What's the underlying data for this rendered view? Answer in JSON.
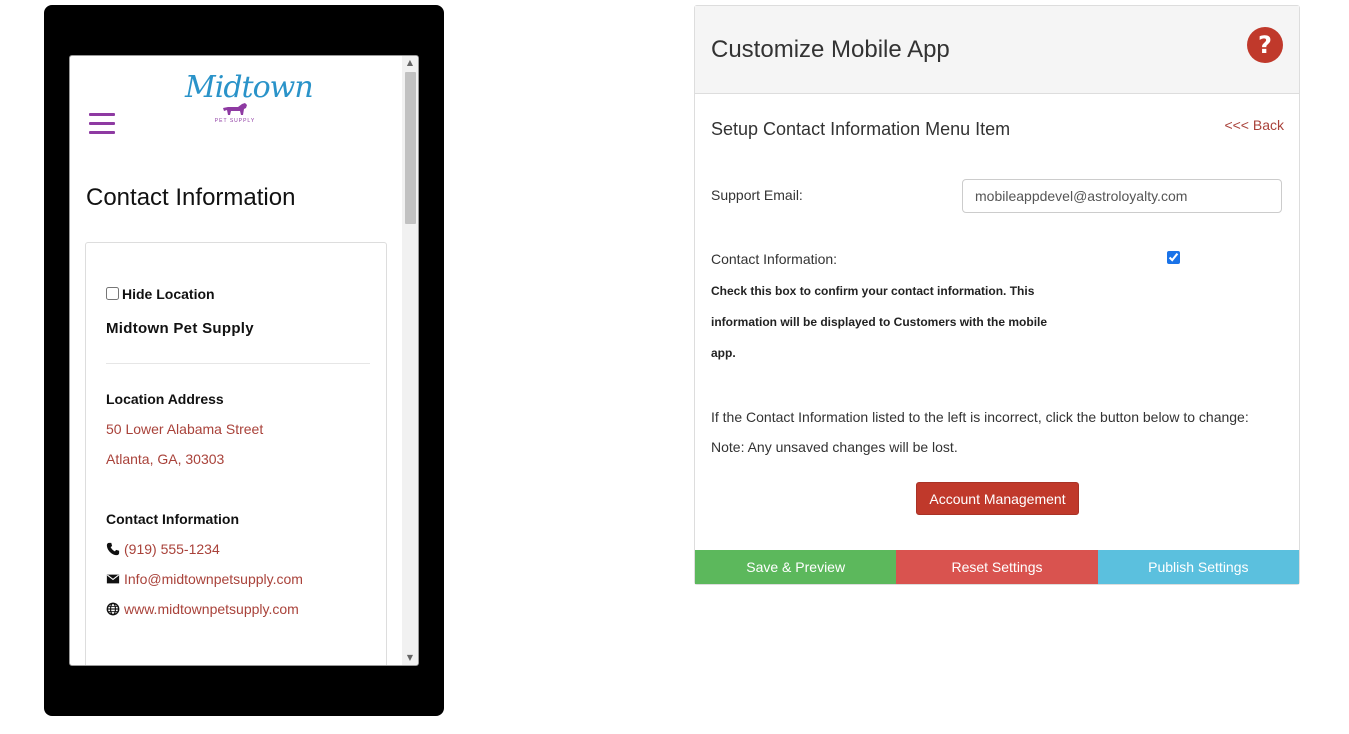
{
  "phone": {
    "logo": {
      "word": "Midtown",
      "sub": "PET SUPPLY"
    },
    "title": "Contact Information",
    "hide_location_label": "Hide Location",
    "location_name": "Midtown Pet Supply",
    "address_label": "Location Address",
    "address_line1": "50 Lower Alabama Street",
    "address_line2": "Atlanta, GA, 30303",
    "contact_label": "Contact Information",
    "phone_number": "(919) 555-1234",
    "email": "Info@midtownpetsupply.com",
    "website": "www.midtownpetsupply.com"
  },
  "panel": {
    "title": "Customize Mobile App",
    "help_label": "?",
    "subtitle": "Setup Contact Information Menu Item",
    "back_label": "<<< Back",
    "support_email_label": "Support Email:",
    "support_email_value": "mobileappdevel@astroloyalty.com",
    "contact_info_label": "Contact Information:",
    "contact_info_checked": true,
    "contact_help_text": "Check this box to confirm your contact information. This information will be displayed to Customers with the mobile app.",
    "incorrect_text": "If the Contact Information listed to the left is incorrect, click the button below to change:",
    "note_text": "Note: Any unsaved changes will be lost.",
    "account_button": "Account Management",
    "save_button": "Save & Preview",
    "reset_button": "Reset Settings",
    "publish_button": "Publish Settings"
  },
  "colors": {
    "accent_red": "#c0392b",
    "link": "#a9423a",
    "hamburger": "#8e3aa2",
    "save": "#5cb85c",
    "reset": "#d9534f",
    "publish": "#5bc0de"
  }
}
